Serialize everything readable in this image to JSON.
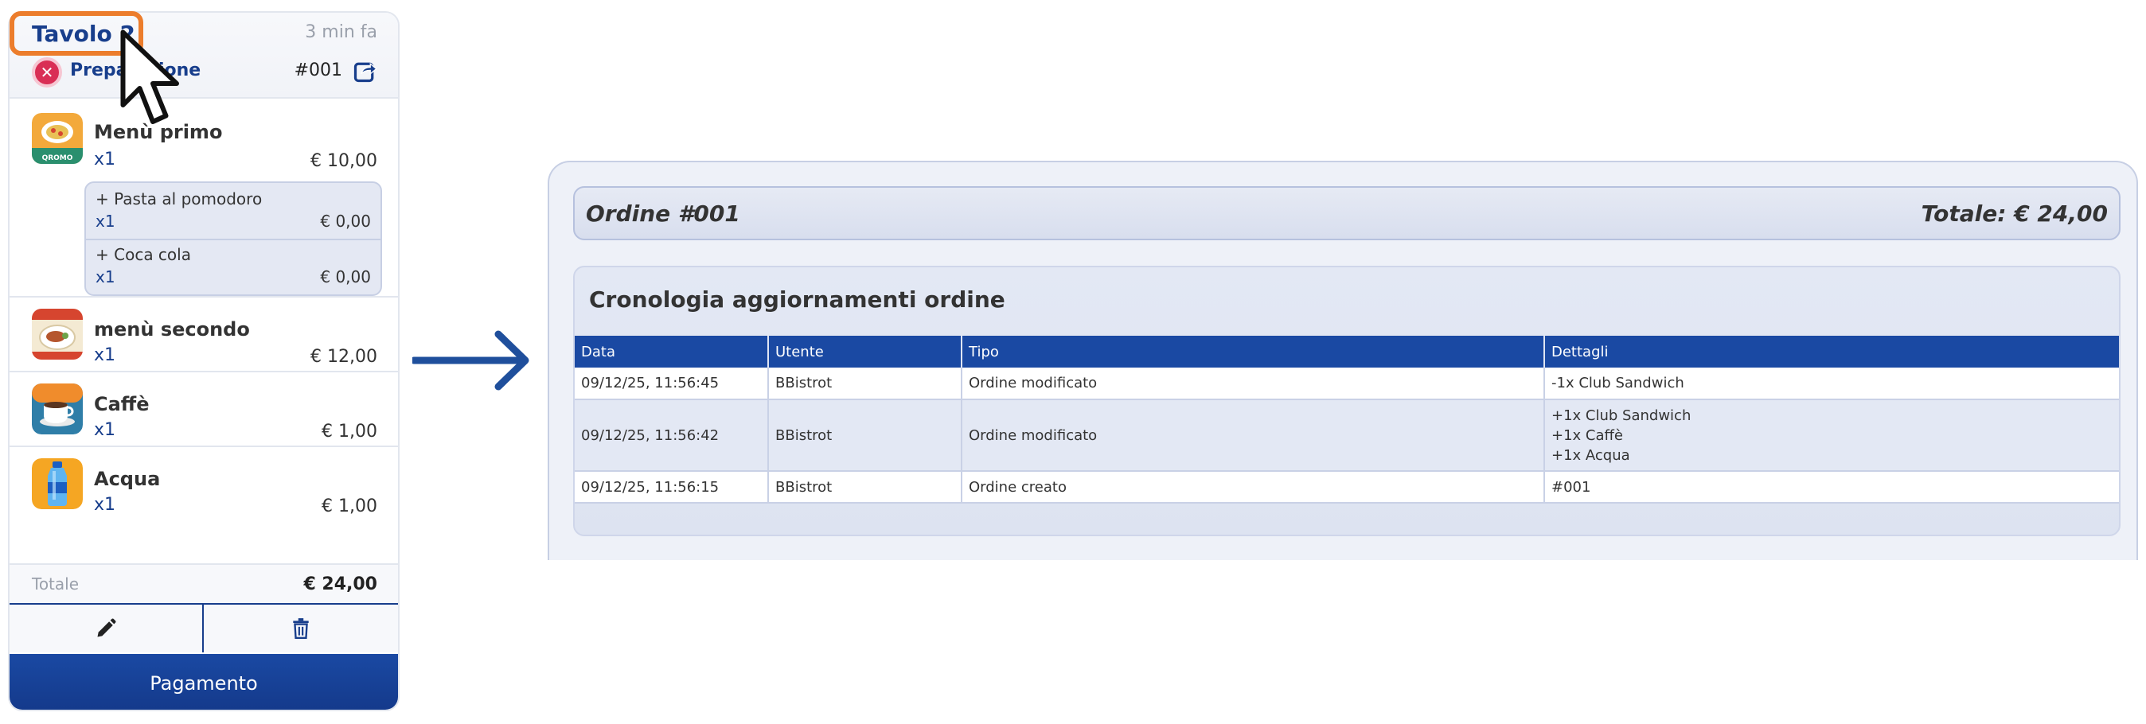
{
  "card": {
    "table_name": "Tavolo 2",
    "time_ago": "3 min fa",
    "status": "Preparazione",
    "order_number": "#001",
    "items": [
      {
        "name": "Menù primo",
        "qty": "x1",
        "price": "€ 10,00",
        "icon": "menu-primo-image"
      },
      {
        "name": "menù secondo",
        "qty": "x1",
        "price": "€ 12,00",
        "icon": "menu-secondo-image"
      },
      {
        "name": "Caffè",
        "qty": "x1",
        "price": "€ 1,00",
        "icon": "coffee-cup-icon"
      },
      {
        "name": "Acqua",
        "qty": "x1",
        "price": "€ 1,00",
        "icon": "water-bottle-icon"
      }
    ],
    "sub_items": [
      {
        "name": "+ Pasta al pomodoro",
        "qty": "x1",
        "price": "€ 0,00"
      },
      {
        "name": "+ Coca cola",
        "qty": "x1",
        "price": "€ 0,00"
      }
    ],
    "total_label": "Totale",
    "total_value": "€ 24,00",
    "pay_label": "Pagamento",
    "menu_primo_badge": "QROMO"
  },
  "panel": {
    "title": "Ordine #001",
    "total": "Totale: € 24,00",
    "history_title": "Cronologia aggiornamenti ordine",
    "columns": [
      "Data",
      "Utente",
      "Tipo",
      "Dettagli"
    ],
    "rows": [
      {
        "date": "09/12/25, 11:56:45",
        "user": "BBistrot",
        "type": "Ordine modificato",
        "details": [
          "-1x Club Sandwich"
        ]
      },
      {
        "date": "09/12/25, 11:56:42",
        "user": "BBistrot",
        "type": "Ordine modificato",
        "details": [
          "+1x Club Sandwich",
          "+1x Caffè",
          "+1x Acqua"
        ]
      },
      {
        "date": "09/12/25, 11:56:15",
        "user": "BBistrot",
        "type": "Ordine creato",
        "details": [
          "#001"
        ]
      }
    ]
  },
  "colors": {
    "brand_blue": "#1a49a3",
    "highlight_orange": "#ec7d2c",
    "status_red": "#d92e55"
  }
}
